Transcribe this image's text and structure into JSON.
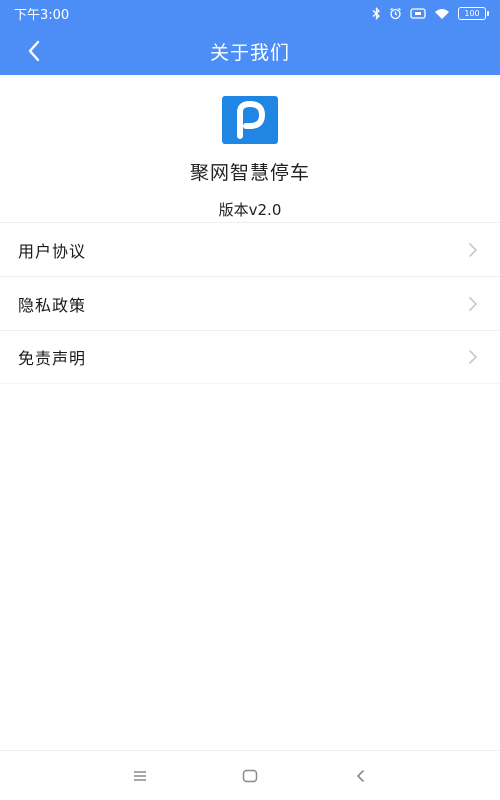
{
  "status_bar": {
    "time": "下午3:00",
    "battery": "100",
    "icons": [
      "bluetooth-icon",
      "alarm-icon",
      "sim-icon",
      "wifi-icon",
      "battery-icon"
    ]
  },
  "header": {
    "title": "关于我们",
    "back_icon": "back-arrow-icon",
    "background": "#4d8df6"
  },
  "app": {
    "name": "聚网智慧停车",
    "version": "版本v2.0",
    "logo_icon": "parking-p-logo",
    "logo_color": "#1f87e3"
  },
  "menu": {
    "items": [
      {
        "label": "用户协议"
      },
      {
        "label": "隐私政策"
      },
      {
        "label": "免责声明"
      }
    ],
    "chevron_icon": "chevron-right-icon"
  },
  "nav_bar": {
    "buttons": [
      "menu-icon",
      "home-icon",
      "back-icon"
    ]
  }
}
